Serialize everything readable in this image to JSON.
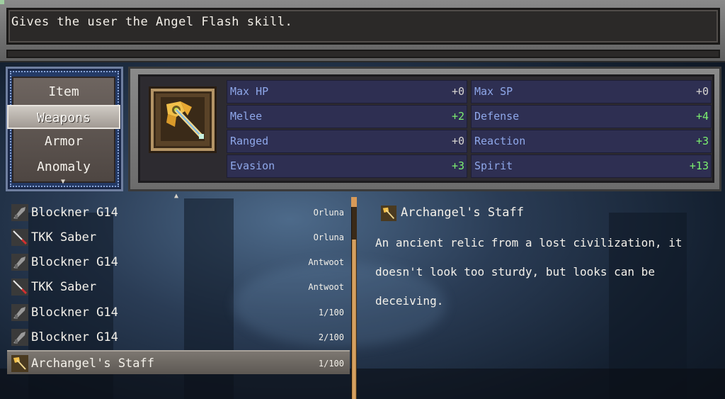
{
  "description": "Gives the user the Angel Flash skill.",
  "categories": [
    "Item",
    "Weapons",
    "Armor",
    "Anomaly"
  ],
  "active_category": "Weapons",
  "stats": [
    {
      "label": "Max HP",
      "value": "+0",
      "positive": false
    },
    {
      "label": "Max SP",
      "value": "+0",
      "positive": false
    },
    {
      "label": "Melee",
      "value": "+2",
      "positive": true
    },
    {
      "label": "Defense",
      "value": "+4",
      "positive": true
    },
    {
      "label": "Ranged",
      "value": "+0",
      "positive": false
    },
    {
      "label": "Reaction",
      "value": "+3",
      "positive": true
    },
    {
      "label": "Evasion",
      "value": "+3",
      "positive": true
    },
    {
      "label": "Spirit",
      "value": "+13",
      "positive": true
    }
  ],
  "items": [
    {
      "name": "Blockner G14",
      "owner": "Orluna",
      "icon": "gun-icon"
    },
    {
      "name": "TKK Saber",
      "owner": "Orluna",
      "icon": "saber-icon"
    },
    {
      "name": "Blockner G14",
      "owner": "Antwoot",
      "icon": "gun-icon"
    },
    {
      "name": "TKK Saber",
      "owner": "Antwoot",
      "icon": "saber-icon"
    },
    {
      "name": "Blockner G14",
      "owner": "1/100",
      "icon": "gun-icon"
    },
    {
      "name": "Blockner G14",
      "owner": "2/100",
      "icon": "gun-icon"
    },
    {
      "name": "Archangel's Staff",
      "owner": "1/100",
      "icon": "staff-icon"
    }
  ],
  "selected_item": {
    "name": "Archangel's Staff",
    "text": "An ancient relic from a lost civilization, it doesn't look too sturdy, but looks can be deceiving."
  },
  "colors": {
    "stat_label": "#8fa8ea",
    "stat_positive": "#7cf070",
    "stat_neutral": "#d8d6d2"
  }
}
